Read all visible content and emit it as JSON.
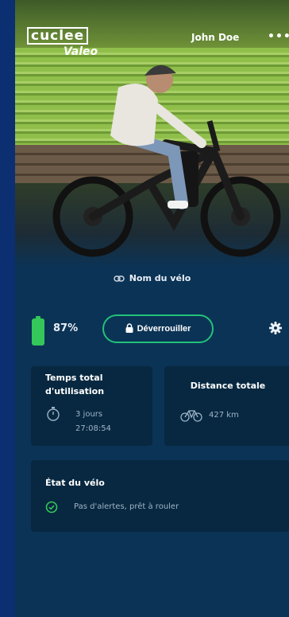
{
  "header": {
    "logo_text": "cuclee",
    "logo_subtext": "Valeo",
    "user_name": "John Doe",
    "more_glyph": "•••"
  },
  "bike": {
    "name": "Nom du vélo"
  },
  "status": {
    "battery_percent": "87%",
    "unlock_label": "Déverrouiller"
  },
  "usage_card": {
    "title": "Temps total d'utilisation",
    "value_line1": "3 jours",
    "value_line2": "27:08:54"
  },
  "distance_card": {
    "title": "Distance totale",
    "value": "427 km"
  },
  "state_card": {
    "title": "État du vélo",
    "message": "Pas d'alertes, prêt à rouler"
  },
  "colors": {
    "accent_green": "#21c27a",
    "battery_green": "#34c759",
    "background": "#0b3355",
    "card": "#072840",
    "outer_frame": "#0c2f72"
  },
  "icons": [
    "more-icon",
    "link-icon",
    "battery-icon",
    "lock-icon",
    "gear-icon",
    "stopwatch-icon",
    "bicycle-icon",
    "check-circle-icon"
  ]
}
